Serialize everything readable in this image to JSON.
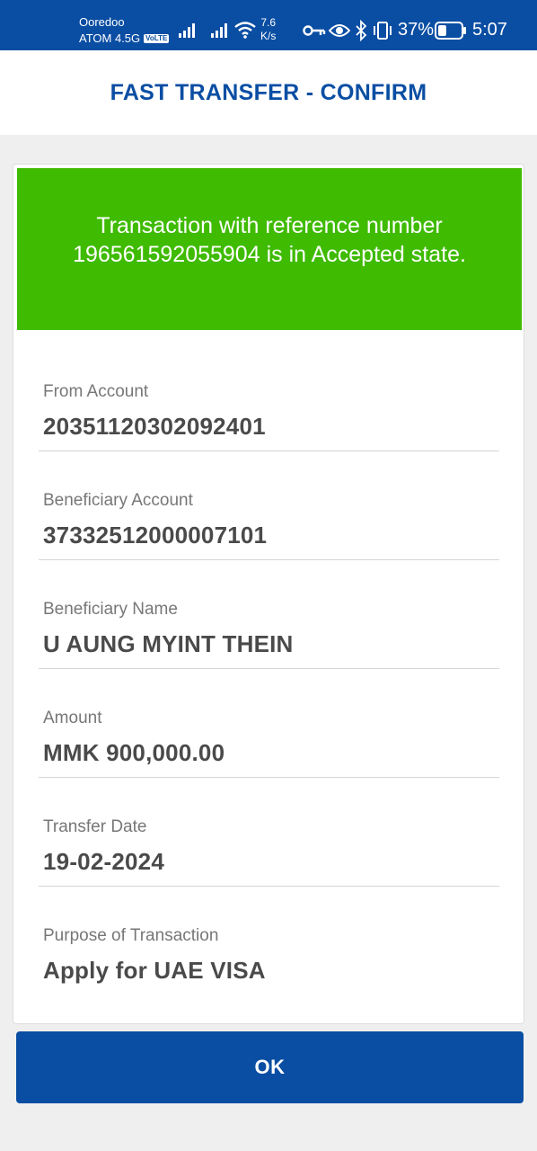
{
  "status_bar": {
    "carrier_name": "Ooredoo",
    "network": "ATOM 4.5G",
    "volte_badge": "VoLTE",
    "net_speed_value": "7.6",
    "net_speed_unit": "K/s",
    "battery_percent": "37%",
    "battery_level": 0.37,
    "time": "5:07",
    "icons": [
      "signal-icon",
      "signal-icon",
      "wifi-icon",
      "vpn-key-icon",
      "eye-icon",
      "bluetooth-icon",
      "vibrate-icon",
      "battery-icon"
    ]
  },
  "header": {
    "title": "FAST TRANSFER - CONFIRM"
  },
  "banner": {
    "message": "Transaction with reference  number 196561592055904 is in Accepted state.",
    "color": "#3fbb01"
  },
  "fields": [
    {
      "label": "From Account",
      "value": "20351120302092401"
    },
    {
      "label": "Beneficiary Account",
      "value": "37332512000007101"
    },
    {
      "label": "Beneficiary Name",
      "value": "U AUNG MYINT THEIN"
    },
    {
      "label": "Amount",
      "value": "MMK 900,000.00"
    },
    {
      "label": "Transfer Date",
      "value": "19-02-2024"
    },
    {
      "label": "Purpose of Transaction",
      "value": "Apply for UAE VISA"
    }
  ],
  "actions": {
    "ok_label": "OK"
  },
  "colors": {
    "brand": "#0a4ea3",
    "success": "#3fbb01",
    "background": "#efefef"
  }
}
